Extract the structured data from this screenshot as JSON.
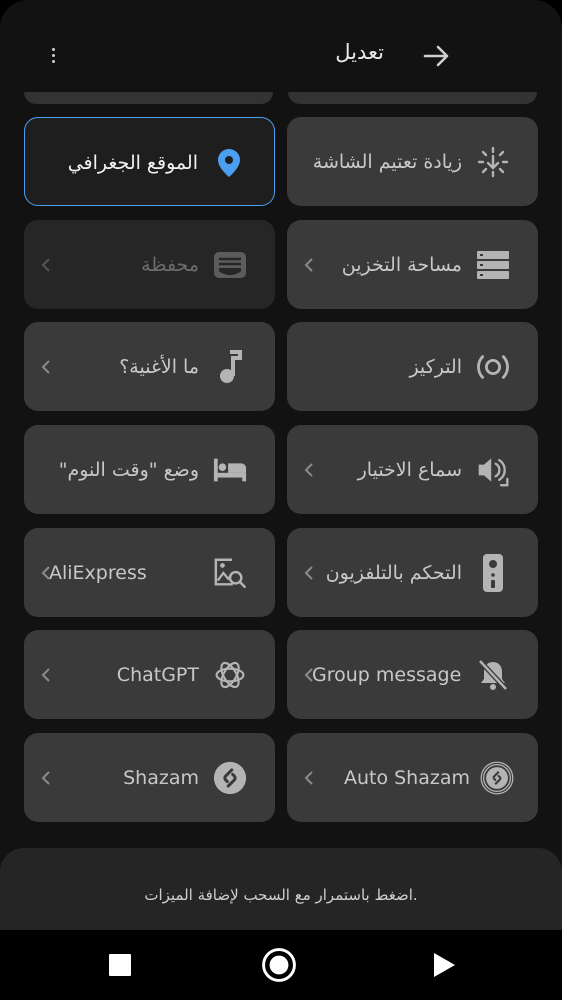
{
  "header": {
    "title": "تعديل",
    "more_icon": "more-vertical-icon",
    "back_icon": "arrow-right-icon"
  },
  "tiles": [
    {
      "label": "الموقع الجغرافي",
      "icon": "location-pin-icon",
      "state": "selected",
      "accent": "#4c9ff0"
    },
    {
      "label": "زيادة تعتيم الشاشة",
      "icon": "extra-dim-icon",
      "state": "normal"
    },
    {
      "label": "محفظة",
      "icon": "wallet-icon",
      "state": "disabled"
    },
    {
      "label": "مساحة التخزين",
      "icon": "storage-icon",
      "state": "normal"
    },
    {
      "label": "ما الأغنية؟",
      "icon": "music-note-icon",
      "state": "normal"
    },
    {
      "label": "التركيز",
      "icon": "focus-icon",
      "state": "normal"
    },
    {
      "label": "وضع \"وقت النوم\"",
      "icon": "bed-icon",
      "state": "normal"
    },
    {
      "label": "سماع الاختيار",
      "icon": "select-to-speak-icon",
      "state": "normal"
    },
    {
      "label": "AliExpress",
      "icon": "image-search-icon",
      "state": "normal"
    },
    {
      "label": "التحكم بالتلفزيون",
      "icon": "tv-remote-icon",
      "state": "normal"
    },
    {
      "label": "ChatGPT",
      "icon": "chatgpt-icon",
      "state": "normal"
    },
    {
      "label": "Group messages",
      "icon": "notifications-off-icon",
      "state": "normal"
    },
    {
      "label": "Shazam",
      "icon": "shazam-icon",
      "state": "normal"
    },
    {
      "label": "Auto Shazam",
      "icon": "auto-shazam-icon",
      "state": "normal"
    }
  ],
  "footer": {
    "hint": "اضغط باستمرار مع السحب لإضافة الميزات."
  },
  "navbar": {
    "recents_icon": "square-icon",
    "home_icon": "circle-icon",
    "back_icon": "triangle-icon"
  }
}
